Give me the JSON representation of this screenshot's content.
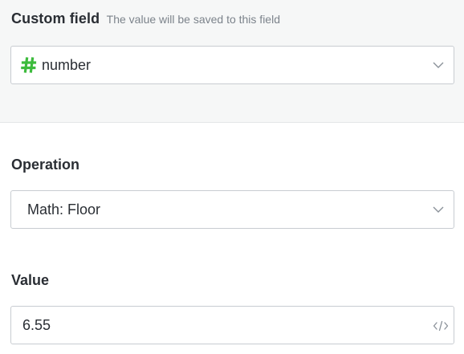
{
  "custom_field": {
    "label": "Custom field",
    "hint": "The value will be saved to this field",
    "selected_value": "number",
    "icon": "hash-icon",
    "icon_color": "#3dbb3d"
  },
  "operation": {
    "label": "Operation",
    "selected_value": "Math: Floor"
  },
  "value": {
    "label": "Value",
    "current_value": "6.55",
    "icon": "code-icon"
  },
  "colors": {
    "top_background": "#f6f7f7",
    "border": "#c8ccd1",
    "text": "#2a2e34",
    "hint_text": "#7c838b"
  }
}
